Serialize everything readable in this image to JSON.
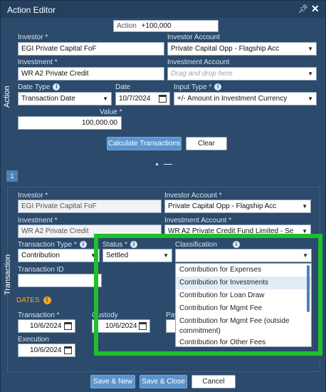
{
  "window": {
    "title": "Action Editor"
  },
  "action_section": {
    "side_label": "Action",
    "action_field": {
      "label": "Action",
      "value": "+100,000"
    },
    "investor": {
      "label": "Investor",
      "value": "EGI Private Capital FoF"
    },
    "investor_account": {
      "label": "Investor Account",
      "value": "Private Capital Opp - Flagship Acc"
    },
    "investment": {
      "label": "Investment",
      "value": "WR A2 Private Credit"
    },
    "investment_account": {
      "label": "Investment Account",
      "placeholder": "Drag and drop here"
    },
    "date_type": {
      "label": "Date Type",
      "value": "Transaction Date"
    },
    "date": {
      "label": "Date",
      "value": "10/7/2024"
    },
    "input_type": {
      "label": "Input Type",
      "value": "+/- Amount in Investment Currency"
    },
    "value": {
      "label": "Value",
      "value": "100,000.00"
    },
    "calculate_label": "Calculate Transactions",
    "clear_label": "Clear"
  },
  "transaction_section": {
    "side_label": "Transaction",
    "badge": "1",
    "investor": {
      "label": "Investor",
      "value": "EGI Private Capital FoF"
    },
    "investor_account": {
      "label": "Investor Account",
      "value": "Private Capital Opp - Flagship Acc"
    },
    "investment": {
      "label": "Investment",
      "value": "WR A2 Private Credit"
    },
    "investment_account": {
      "label": "Investment Account",
      "value": "WR A2 Private Credit Fund Limited - Se"
    },
    "transaction_type": {
      "label": "Transaction Type",
      "value": "Contribution"
    },
    "status": {
      "label": "Status",
      "value": "Settled"
    },
    "classification": {
      "label": "Classification",
      "value": "",
      "options": [
        "Contribution for Expenses",
        "Contribution for Investments",
        "Contribution for Loan Draw",
        "Contribution for Mgmt Fee",
        "Contribution for Mgmt Fee (outside commitment)",
        "Contribution for Other Fees"
      ],
      "highlighted_index": 1
    },
    "transaction_id": {
      "label": "Transaction ID",
      "value": ""
    },
    "dates_heading": "DATES",
    "transaction_date": {
      "label": "Transaction",
      "value": "10/6/2024"
    },
    "custody_date": {
      "label": "Custody",
      "value": "10/6/2024"
    },
    "pay_date": {
      "label": "Pay"
    },
    "execution_date": {
      "label": "Execution",
      "value": "10/6/2024"
    }
  },
  "footer": {
    "save_new_label": "Save & New",
    "save_close_label": "Save & Close",
    "cancel_label": "Cancel"
  },
  "colors": {
    "panel_bg": "#2c4a6b",
    "accent_button": "#5b95cf",
    "highlight_box": "#1ec02c"
  }
}
